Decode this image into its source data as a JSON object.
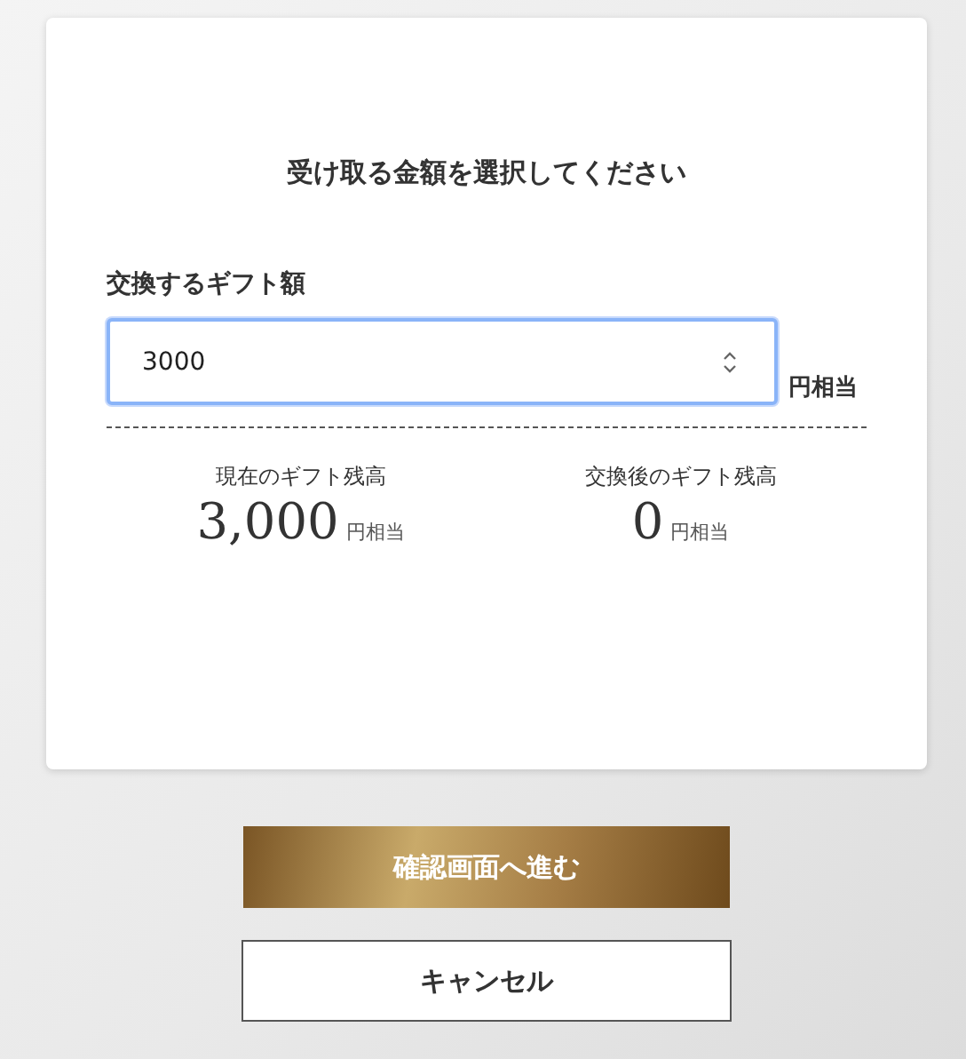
{
  "card": {
    "title": "受け取る金額を選択してください",
    "field": {
      "label": "交換するギフト額",
      "value": "3000",
      "focused": true,
      "unit": "円相当"
    },
    "balances": [
      {
        "label": "現在のギフト残高",
        "amount": "3,000",
        "unit": "円相当"
      },
      {
        "label": "交換後のギフト残高",
        "amount": "0",
        "unit": "円相当"
      }
    ]
  },
  "buttons": [
    {
      "label": "確認画面へ進む",
      "kind": "primary"
    },
    {
      "label": "キャンセル",
      "kind": "secondary"
    }
  ]
}
